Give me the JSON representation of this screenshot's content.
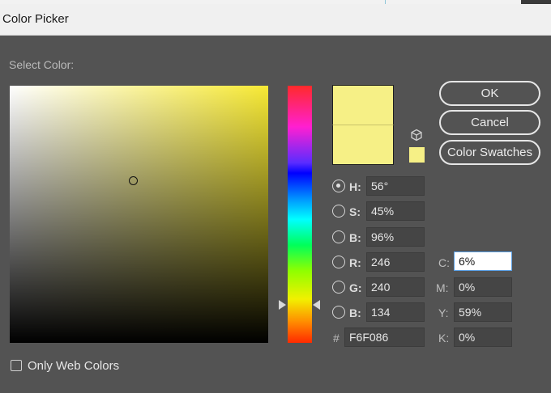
{
  "window": {
    "title": "Color Picker"
  },
  "picker": {
    "label": "Select Color:"
  },
  "buttons": {
    "ok": "OK",
    "cancel": "Cancel",
    "swatches": "Color Swatches"
  },
  "hsb": [
    {
      "label": "H:",
      "value": "56°",
      "selected": true
    },
    {
      "label": "S:",
      "value": "45%",
      "selected": false
    },
    {
      "label": "B:",
      "value": "96%",
      "selected": false
    }
  ],
  "rgb": [
    {
      "label": "R:",
      "value": "246"
    },
    {
      "label": "G:",
      "value": "240"
    },
    {
      "label": "B:",
      "value": "134"
    }
  ],
  "hex": {
    "label": "#",
    "value": "F6F086"
  },
  "cmyk": [
    {
      "label": "C:",
      "value": "6%"
    },
    {
      "label": "M:",
      "value": "0%"
    },
    {
      "label": "Y:",
      "value": "59%"
    },
    {
      "label": "K:",
      "value": "0%"
    }
  ],
  "options": {
    "web_colors": "Only Web Colors"
  },
  "colors": {
    "new": "#f6f086",
    "current": "#f6f086",
    "field_hue": "#f7e934"
  },
  "icons": {
    "websafe": "cube-icon"
  }
}
